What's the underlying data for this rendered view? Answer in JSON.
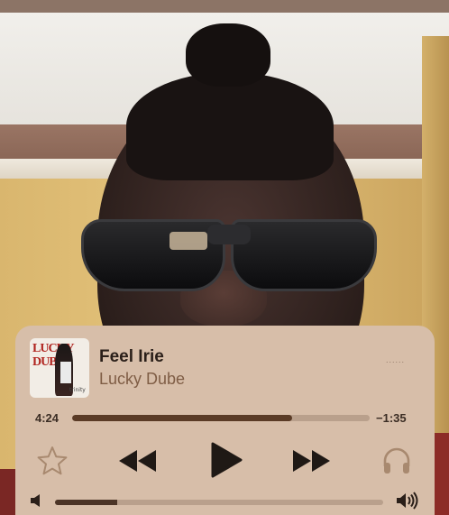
{
  "now_playing": {
    "title": "Feel Irie",
    "artist": "Lucky Dube",
    "more_dots": "......",
    "album_art": {
      "text_line1": "LUCKY",
      "text_line2": "DUBE",
      "script": "trinity"
    }
  },
  "progress": {
    "elapsed": "4:24",
    "remaining": "−1:35",
    "fraction": 0.74
  },
  "controls": {
    "favorite_icon": "star-icon",
    "previous_icon": "rewind-icon",
    "play_icon": "play-icon",
    "next_icon": "fast-forward-icon",
    "output_icon": "headphones-icon"
  },
  "volume": {
    "level": 0.19,
    "low_icon": "speaker-low-icon",
    "high_icon": "speaker-high-icon"
  },
  "colors": {
    "card_background": "#d7bea9",
    "accent_dark": "#5a3b26",
    "artist_text": "#7f5d45"
  }
}
